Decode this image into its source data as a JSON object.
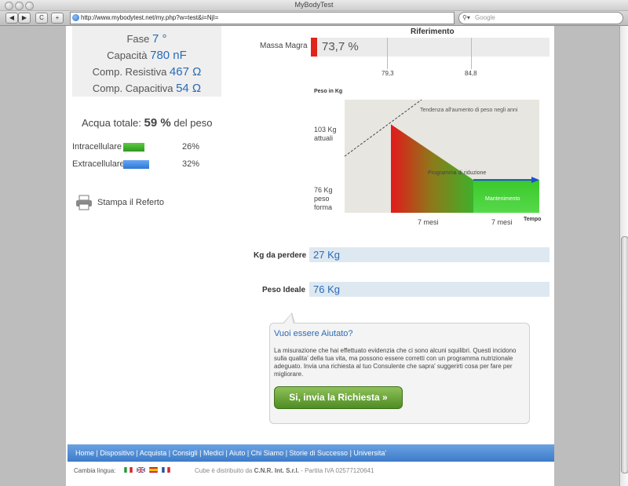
{
  "window": {
    "title": "MyBodyTest"
  },
  "toolbar": {
    "back": "◀",
    "forward": "▶",
    "reload": "C",
    "add": "+",
    "url": "http://www.mybodytest.net/my.php?w=test&i=NjI=",
    "search_placeholder": "Google"
  },
  "left": {
    "fase_label": "Fase",
    "fase_value": "7 °",
    "capacita_label": "Capacità",
    "capacita_value": "780 nF",
    "resistiva_label": "Comp. Resistiva",
    "resistiva_value": "467 Ω",
    "capacitiva_label": "Comp. Capacitiva",
    "capacitiva_value": "54 Ω",
    "acqua_label": "Acqua totale:",
    "acqua_value": "59 %",
    "acqua_suffix": "del peso",
    "intra_label": "Intracellulare",
    "intra_pct": "26%",
    "intra_fill": 0.26,
    "extra_label": "Extracellulare",
    "extra_pct": "32%",
    "extra_fill": 0.32,
    "stampa": "Stampa il Referto"
  },
  "massa": {
    "riferimento": "Riferimento",
    "label": "Massa Magra",
    "value": "73,7 %",
    "ticks": [
      "79,3",
      "84,8"
    ]
  },
  "chart_data": {
    "type": "line",
    "ylabel": "Peso in Kg",
    "xlabel": "Tempo",
    "annotations": [
      "Tendenza all'aumento di peso negli anni",
      "Programma di riduzione",
      "Mantenimento"
    ],
    "y_labels": [
      {
        "value": 103,
        "line1": "103 Kg",
        "line2": "attuali"
      },
      {
        "value": 76,
        "line1": "76 Kg",
        "line2": "peso",
        "line3": "forma"
      }
    ],
    "x_labels": [
      "7 mesi",
      "7 mesi"
    ],
    "series": [
      {
        "values": [
          103,
          76,
          76
        ]
      }
    ]
  },
  "kg_perdere": {
    "label": "Kg da perdere",
    "value": "27 Kg"
  },
  "peso_ideale": {
    "label": "Peso Ideale",
    "value": "76 Kg"
  },
  "aiuto": {
    "title": "Vuoi essere Aiutato?",
    "text": "La misurazione che hai effettuato evidenzia che ci sono alcuni squilibri. Questi incidono sulla qualita' della tua vita, ma possono essere corretti con un programma nutrizionale adeguato. Invia una richiesta al tuo Consulente che sapra' suggerirti cosa per fare per migliorare.",
    "button": "Si, invia la Richiesta »"
  },
  "footer": {
    "links": [
      "Home",
      "Dispositivo",
      "Acquista",
      "Consigli",
      "Medici",
      "Aiuto",
      "Chi Siamo",
      "Storie di Successo",
      "Universita'"
    ],
    "lang_label": "Cambia lingua:",
    "copyright_pre": "Cube è distribuito da",
    "copyright_company": "C.N.R. Int. S.r.l.",
    "copyright_post": "- Partita IVA 02577120641"
  },
  "colors": {
    "accent": "#2a6bb6",
    "green": "#3fb02a",
    "red": "#e0231b",
    "footer": "#3e7cc9"
  }
}
